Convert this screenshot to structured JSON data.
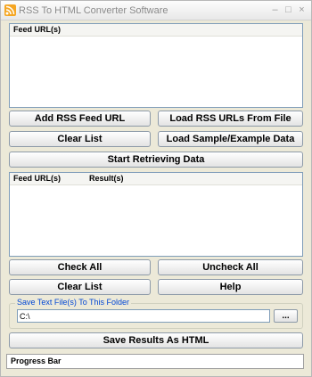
{
  "window": {
    "title": "RSS To HTML Converter Software",
    "app_icon": "rss-feed-icon",
    "minimize_glyph": "–",
    "maximize_glyph": "□",
    "close_glyph": "×"
  },
  "feed_list": {
    "header": "Feed URL(s)"
  },
  "buttons": {
    "add_rss": "Add RSS Feed URL",
    "load_rss": "Load RSS URLs From File",
    "clear_list": "Clear List",
    "load_sample": "Load Sample/Example Data",
    "start": "Start Retrieving Data",
    "check_all": "Check All",
    "uncheck_all": "Uncheck All",
    "clear_list_2": "Clear List",
    "help": "Help",
    "save_html": "Save Results As HTML",
    "browse": "..."
  },
  "results_list": {
    "columns": [
      "Feed URL(s)",
      "Result(s)"
    ]
  },
  "save_folder": {
    "legend": "Save Text File(s) To This Folder",
    "path": "C:\\"
  },
  "progress": {
    "label": "Progress Bar"
  },
  "colors": {
    "window_bg": "#ece9d8",
    "legend_text": "#0046d5",
    "input_border": "#7f9db9"
  }
}
